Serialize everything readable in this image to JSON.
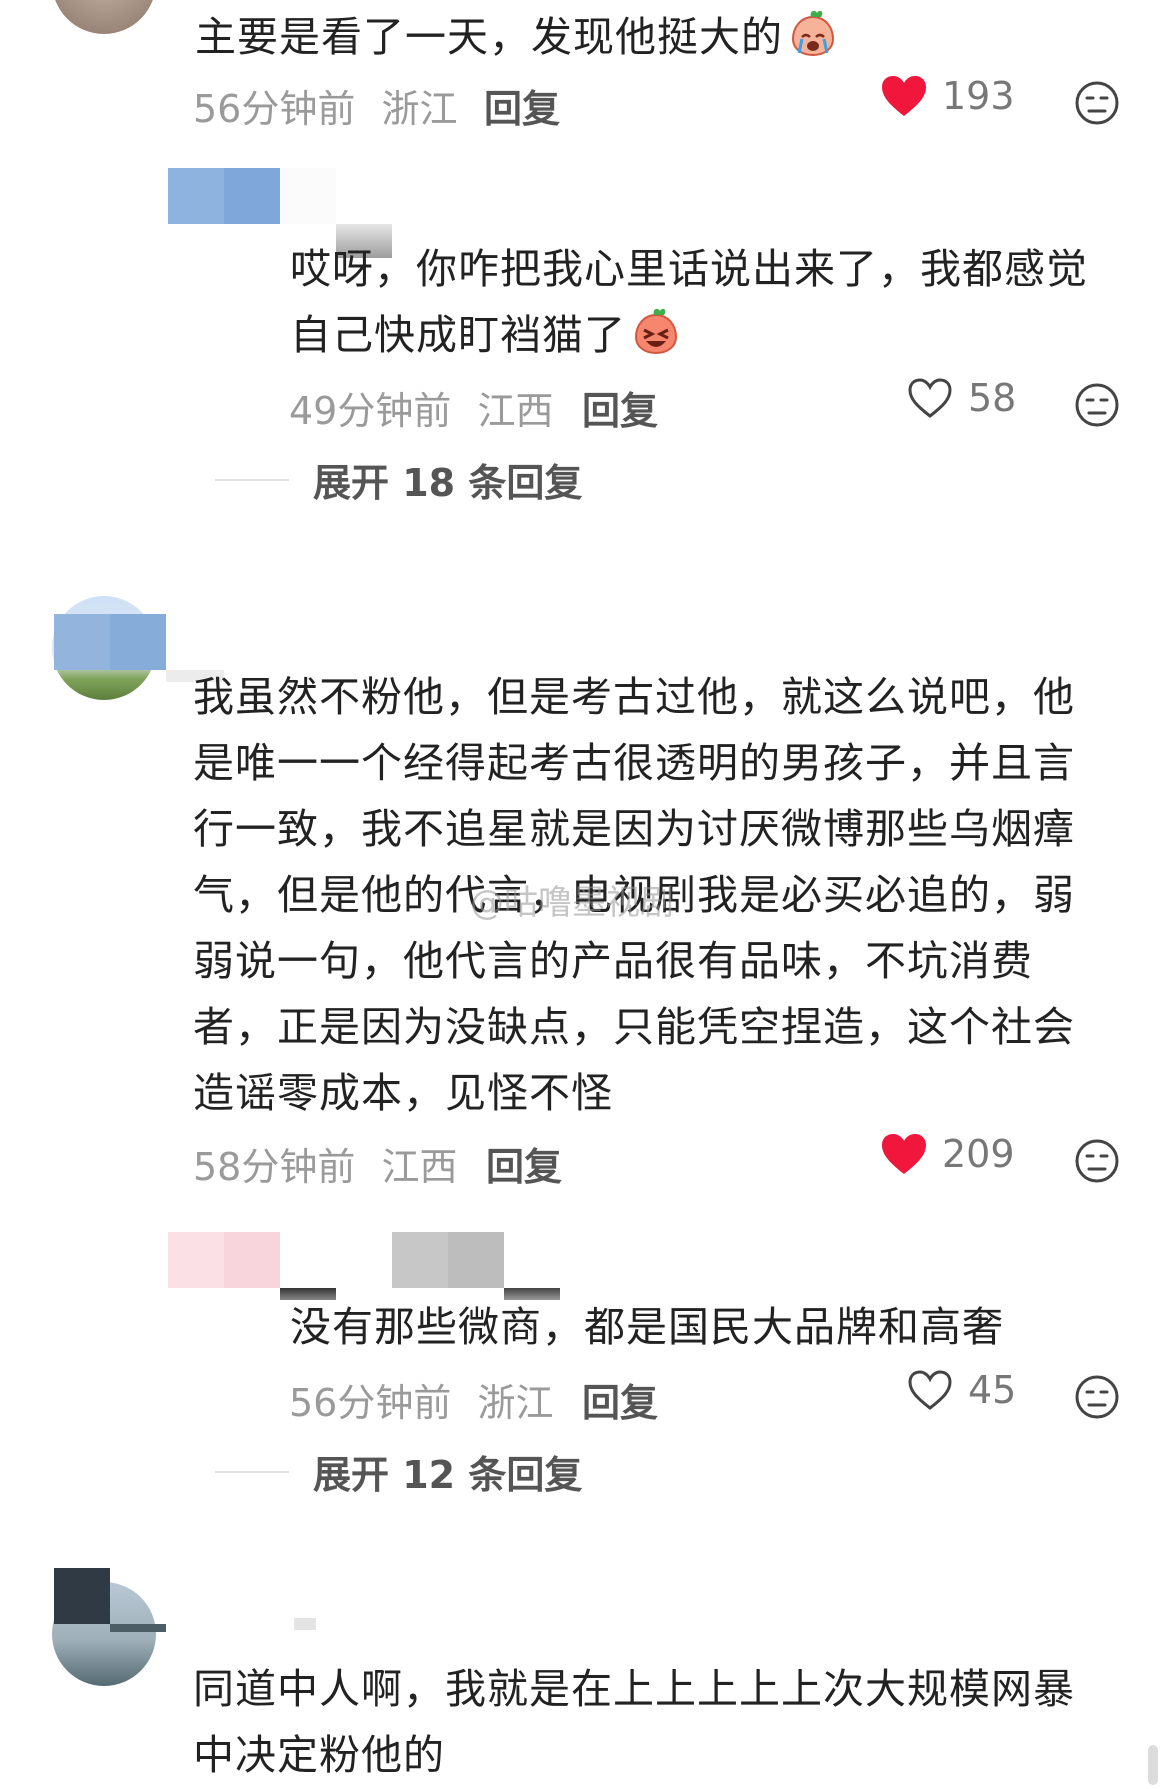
{
  "comments": [
    {
      "text": "主要是看了一天，发现他挺大的",
      "time": "56分钟前",
      "location": "浙江",
      "reply_label": "回复",
      "likes": "193",
      "liked": true,
      "emoji": "crying-face-emoji"
    },
    {
      "text_lines": [
        "哎呀，你咋把我心里话说出来了，我都感觉",
        "自己快成盯裆猫了"
      ],
      "time": "49分钟前",
      "location": "江西",
      "reply_label": "回复",
      "likes": "58",
      "liked": false,
      "emoji": "laughing-face-emoji"
    },
    {
      "text_lines": [
        "我虽然不粉他，但是考古过他，就这么说吧，他",
        "是唯一一个经得起考古很透明的男孩子，并且言",
        "行一致，我不追星就是因为讨厌微博那些乌烟瘴",
        "气，但是他的代言，电视剧我是必买必追的，弱",
        "弱说一句，他代言的产品很有品味，不坑消费",
        "者，正是因为没缺点，只能凭空捏造，这个社会",
        "造谣零成本，见怪不怪"
      ],
      "time": "58分钟前",
      "location": "江西",
      "reply_label": "回复",
      "likes": "209",
      "liked": true
    },
    {
      "text": "没有那些微商，都是国民大品牌和高奢",
      "time": "56分钟前",
      "location": "浙江",
      "reply_label": "回复",
      "likes": "45",
      "liked": false
    },
    {
      "text_lines": [
        "同道中人啊，我就是在上上上上上次大规模网暴",
        "中决定粉他的"
      ]
    }
  ],
  "expand_1": "展开 18 条回复",
  "expand_2": "展开 12 条回复",
  "watermark": "@咕噜墨视剧",
  "colors": {
    "like_red": "#f0163c",
    "meta_gray": "#9a9a9a",
    "text": "#222222"
  }
}
